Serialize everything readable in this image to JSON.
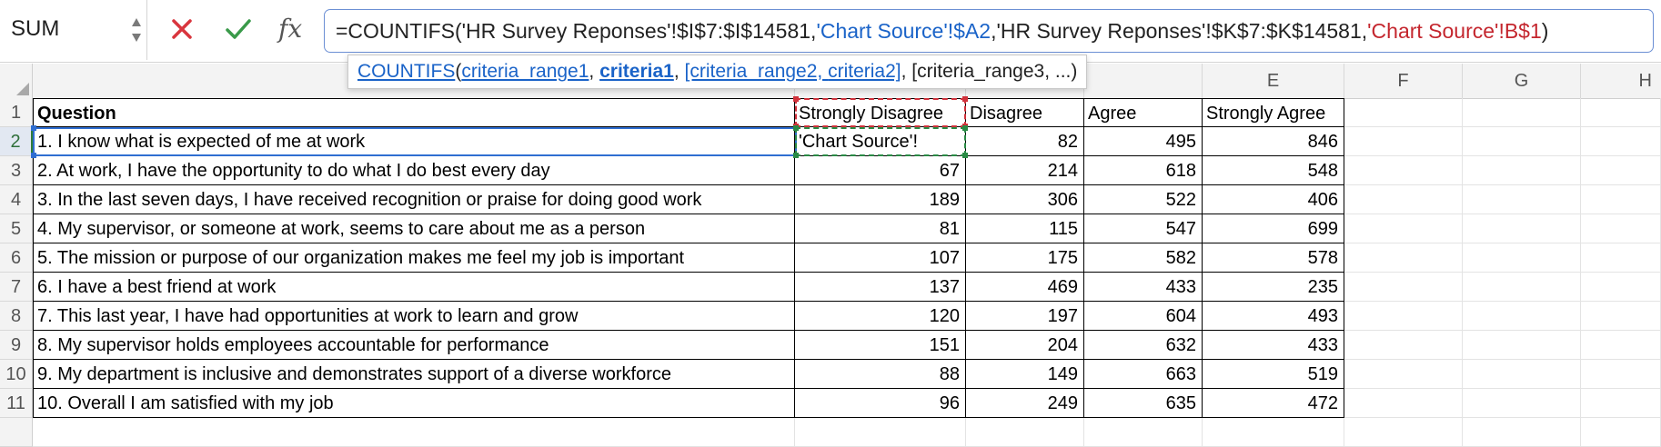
{
  "name_box": {
    "value": "SUM"
  },
  "formula_bar": {
    "fx_label": "fx",
    "segments": [
      {
        "text": "=COUNTIFS('HR Survey Reponses'!$I$7:$I$14581,",
        "color": "black"
      },
      {
        "text": "'Chart Source'!$A2",
        "color": "blue"
      },
      {
        "text": ",'HR Survey Reponses'!$K$7:$K$14581,",
        "color": "black"
      },
      {
        "text": "'Chart Source'!B$1",
        "color": "red"
      },
      {
        "text": ")",
        "color": "black"
      }
    ]
  },
  "tooltip": {
    "fn_name": "COUNTIFS",
    "open_paren": "(",
    "arg1": "criteria_range1",
    "sep1": ", ",
    "arg2": "criteria1",
    "sep2": ", ",
    "arg3": "[criteria_range2, ",
    "arg4": "criteria2]",
    "rest": ", [criteria_range3, ...)"
  },
  "column_headers": [
    "E",
    "F",
    "G",
    "H"
  ],
  "row_numbers": [
    "1",
    "2",
    "3",
    "4",
    "5",
    "6",
    "7",
    "8",
    "9",
    "10",
    "11"
  ],
  "active_row": "2",
  "table": {
    "headers": [
      "Question",
      "Strongly Disagree",
      "Disagree",
      "Agree",
      "Strongly Agree"
    ],
    "editing_cell_text": "'Chart Source'!",
    "rows": [
      {
        "question": "1. I know what is expected of me at work",
        "sd": "",
        "d": "82",
        "a": "495",
        "sa": "846"
      },
      {
        "question": "2. At work, I have the opportunity to do what I do best every day",
        "sd": "67",
        "d": "214",
        "a": "618",
        "sa": "548"
      },
      {
        "question": "3. In the last seven days, I have received recognition or praise for doing good work",
        "sd": "189",
        "d": "306",
        "a": "522",
        "sa": "406"
      },
      {
        "question": "4. My supervisor, or someone at work, seems to care about me as a person",
        "sd": "81",
        "d": "115",
        "a": "547",
        "sa": "699"
      },
      {
        "question": "5. The mission or purpose of our organization makes me feel my job is important",
        "sd": "107",
        "d": "175",
        "a": "582",
        "sa": "578"
      },
      {
        "question": "6. I have a best friend at work",
        "sd": "137",
        "d": "469",
        "a": "433",
        "sa": "235"
      },
      {
        "question": "7. This last year, I have had opportunities at work to learn and grow",
        "sd": "120",
        "d": "197",
        "a": "604",
        "sa": "493"
      },
      {
        "question": "8. My supervisor holds employees accountable for performance",
        "sd": "151",
        "d": "204",
        "a": "632",
        "sa": "433"
      },
      {
        "question": "9. My department is inclusive and demonstrates support of a diverse workforce",
        "sd": "88",
        "d": "149",
        "a": "663",
        "sa": "519"
      },
      {
        "question": "10. Overall I am satisfied with my job",
        "sd": "96",
        "d": "249",
        "a": "635",
        "sa": "472"
      }
    ]
  },
  "colors": {
    "range_blue": "#2f6ed1",
    "range_red": "#d0313b",
    "range_green": "#2a8a45",
    "cancel_red": "#d9363e",
    "enter_green": "#3a9a4a"
  },
  "icons": {
    "cancel": "x-icon",
    "enter": "check-icon",
    "function": "fx-icon",
    "stepper": "stepper-icon"
  }
}
